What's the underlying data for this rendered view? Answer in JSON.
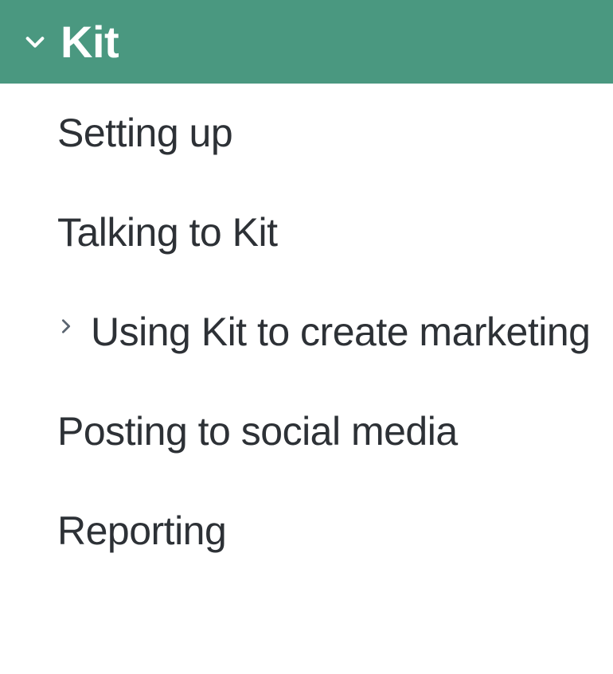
{
  "sidebar": {
    "header": {
      "title": "Kit"
    },
    "items": [
      {
        "label": "Setting up",
        "expandable": false
      },
      {
        "label": "Talking to Kit",
        "expandable": false
      },
      {
        "label": "Using Kit to create marketing",
        "expandable": true
      },
      {
        "label": "Posting to social media",
        "expandable": false
      },
      {
        "label": "Reporting",
        "expandable": false
      }
    ]
  }
}
